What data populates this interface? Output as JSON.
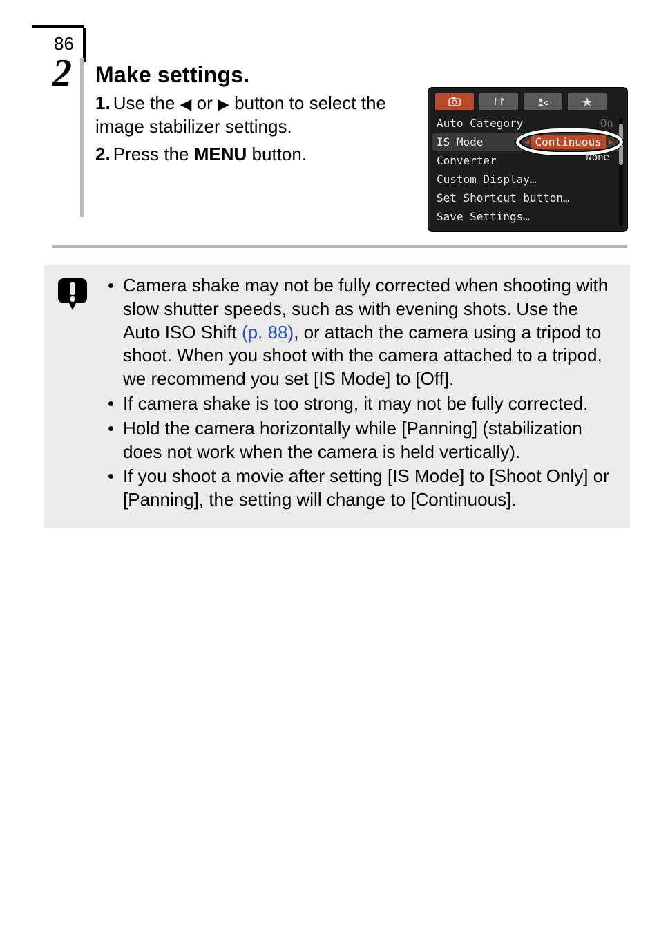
{
  "page": {
    "number": "86"
  },
  "step": {
    "number": "2",
    "heading": "Make settings.",
    "substeps": {
      "one": {
        "num": "1.",
        "parts": {
          "a": "Use the ",
          "b": " or ",
          "c": " button to select the image stabilizer settings."
        }
      },
      "two": {
        "num": "2.",
        "a": "Press the ",
        "menu_word": "MENU",
        "b": " button."
      }
    }
  },
  "camera_menu": {
    "auto_category": {
      "label": "Auto Category",
      "value": "On"
    },
    "is_mode": {
      "label": "IS Mode",
      "value": "Continuous"
    },
    "converter": {
      "label": "Converter",
      "value": "None"
    },
    "custom_display": {
      "label": "Custom Display…"
    },
    "shortcut": {
      "label": "Set Shortcut button…"
    },
    "save_settings": {
      "label": "Save Settings…"
    }
  },
  "caution": {
    "item1": {
      "a": "Camera shake may not be fully corrected when shooting with slow shutter speeds, such as with evening shots. Use the Auto ISO Shift ",
      "link": "(p. 88)",
      "b": ", or attach the camera using a tripod to shoot. When you shoot with the camera attached to a tripod, we recommend you set [IS Mode] to [Off]."
    },
    "item2": "If camera shake is too strong, it may not be fully corrected.",
    "item3": "Hold the camera horizontally while [Panning] (stabilization does not work when the camera is held vertically).",
    "item4": "If you shoot a movie after setting [IS Mode] to [Shoot Only] or [Panning], the setting will change to [Continuous]."
  }
}
